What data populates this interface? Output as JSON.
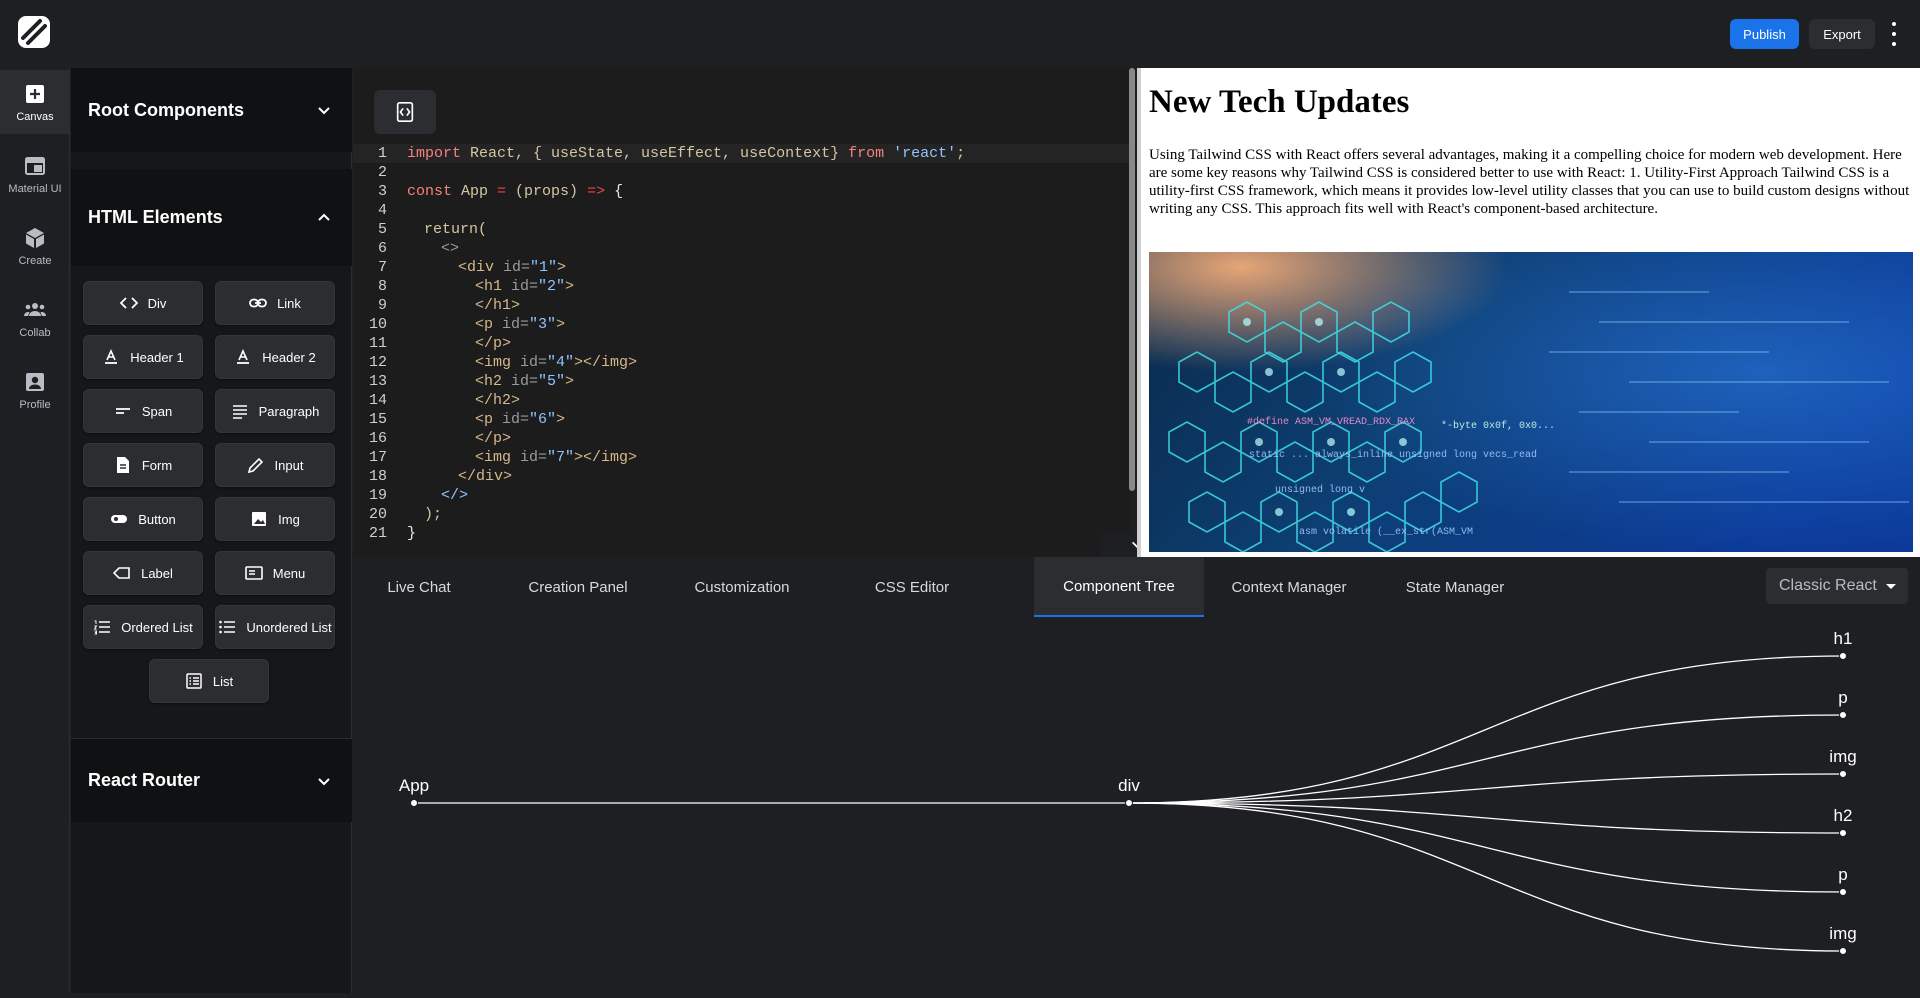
{
  "header": {
    "publish_label": "Publish",
    "export_label": "Export",
    "brand_color": "#1a73e8"
  },
  "rail": {
    "items": [
      {
        "label": "Canvas",
        "icon": "plus-square-icon",
        "active": true
      },
      {
        "label": "Material UI",
        "icon": "window-icon",
        "active": false
      },
      {
        "label": "Create",
        "icon": "cube-icon",
        "active": false
      },
      {
        "label": "Collab",
        "icon": "group-icon",
        "active": false
      },
      {
        "label": "Profile",
        "icon": "account-box-icon",
        "active": false
      }
    ]
  },
  "sidebar": {
    "sections": [
      {
        "title": "Root Components",
        "expanded": false
      },
      {
        "title": "HTML Elements",
        "expanded": true
      },
      {
        "title": "React Router",
        "expanded": false
      }
    ],
    "elements": [
      {
        "label": "Div",
        "icon": "code-icon"
      },
      {
        "label": "Link",
        "icon": "link-icon"
      },
      {
        "label": "Header 1",
        "icon": "text-format-icon"
      },
      {
        "label": "Header 2",
        "icon": "text-format-icon"
      },
      {
        "label": "Span",
        "icon": "short-text-icon"
      },
      {
        "label": "Paragraph",
        "icon": "paragraph-icon"
      },
      {
        "label": "Form",
        "icon": "document-icon"
      },
      {
        "label": "Input",
        "icon": "pencil-icon"
      },
      {
        "label": "Button",
        "icon": "toggle-button-icon"
      },
      {
        "label": "Img",
        "icon": "image-icon"
      },
      {
        "label": "Label",
        "icon": "label-icon"
      },
      {
        "label": "Menu",
        "icon": "menu-window-icon"
      },
      {
        "label": "Ordered List",
        "icon": "ordered-list-icon"
      },
      {
        "label": "Unordered List",
        "icon": "unordered-list-icon"
      },
      {
        "label": "List",
        "icon": "list-icon"
      }
    ]
  },
  "editor": {
    "format_button_icon": "format-code-icon",
    "line_numbers": [
      "1",
      "2",
      "3",
      "4",
      "5",
      "6",
      "7",
      "8",
      "9",
      "10",
      "11",
      "12",
      "13",
      "14",
      "15",
      "16",
      "17",
      "18",
      "19",
      "20",
      "21"
    ],
    "lines": {
      "l1_import": "import",
      "l1_body": " React, { useState, useEffect, useContext} ",
      "l1_from": "from",
      "l1_module": "'react'",
      "l1_end": ";",
      "l3_const": "const",
      "l3_name": " App ",
      "l3_eq": "=",
      "l3_params": " (props) ",
      "l3_arrow": "=>",
      "l3_brace": " {",
      "l5": "return(",
      "l6": "<>",
      "l7_tag": "<div",
      "l7_attr": " id=",
      "l7_val": "\"1\"",
      "l7_close": ">",
      "l8_tag": "<h1",
      "l8_attr": " id=",
      "l8_val": "\"2\"",
      "l8_close": ">",
      "l9": "</h1>",
      "l10_tag": "<p",
      "l10_attr": " id=",
      "l10_val": "\"3\"",
      "l10_close": ">",
      "l11": "</p>",
      "l12_tag": "<img",
      "l12_attr": " id=",
      "l12_val": "\"4\"",
      "l12_close": "></img>",
      "l13_tag": "<h2",
      "l13_attr": " id=",
      "l13_val": "\"5\"",
      "l13_close": ">",
      "l14": "</h2>",
      "l15_tag": "<p",
      "l15_attr": " id=",
      "l15_val": "\"6\"",
      "l15_close": ">",
      "l16": "</p>",
      "l17_tag": "<img",
      "l17_attr": " id=",
      "l17_val": "\"7\"",
      "l17_close": "></img>",
      "l18": "</div>",
      "l19": "</>",
      "l20": ");",
      "l21": "}"
    }
  },
  "preview": {
    "title": "New Tech Updates",
    "paragraph": "Using Tailwind CSS with React offers several advantages, making it a compelling choice for modern web development. Here are some key reasons why Tailwind CSS is considered better to use with React: 1. Utility-First Approach Tailwind CSS is a utility-first CSS framework, which means it provides low-level utility classes that you can use to build custom designs without writing any CSS. This approach fits well with React's component-based architecture.",
    "image_subject": "tech-network-illustration",
    "image_texts": {
      "code1": "#define ASM_VM_VREAD_RDX_RAX",
      "code2": "static ... always_inline unsigned long vecs_read",
      "code3": "unsigned long v",
      "code4": "asm volatile (__ex_str(ASM_VM",
      "code5": "*-byte 0x0f, 0x0..."
    }
  },
  "tabs": {
    "items": [
      {
        "label": "Live Chat",
        "active": false
      },
      {
        "label": "Creation Panel",
        "active": false
      },
      {
        "label": "Customization",
        "active": false
      },
      {
        "label": "CSS Editor",
        "active": false
      },
      {
        "label": "Component Tree",
        "active": true
      },
      {
        "label": "Context Manager",
        "active": false
      },
      {
        "label": "State Manager",
        "active": false
      }
    ],
    "mode_select": "Classic React"
  },
  "tree": {
    "root": "App",
    "child": "div",
    "leaves": [
      "h1",
      "p",
      "img",
      "h2",
      "p",
      "img"
    ]
  }
}
